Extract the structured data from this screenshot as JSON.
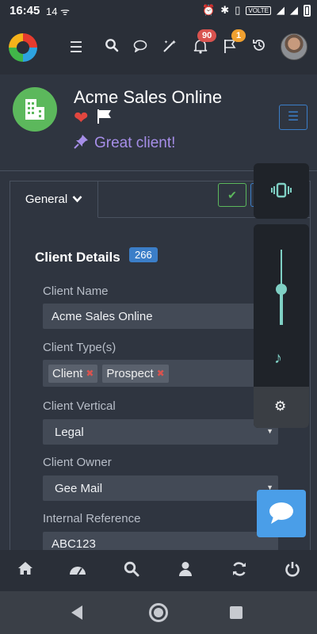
{
  "statusbar": {
    "time": "16:45",
    "left_indicators": "14 ᯤ",
    "volte": "VOLTE"
  },
  "topnav": {
    "notifications_count": "90",
    "flags_count": "1"
  },
  "header": {
    "client_name": "Acme Sales Online",
    "tagline": "Great client!"
  },
  "tabs": {
    "general_label": "General"
  },
  "section": {
    "title": "Client Details",
    "count": "266"
  },
  "form": {
    "client_name_label": "Client Name",
    "client_name_value": "Acme Sales Online",
    "client_types_label": "Client Type(s)",
    "client_types": [
      "Client",
      "Prospect"
    ],
    "client_vertical_label": "Client Vertical",
    "client_vertical_value": "Legal",
    "client_owner_label": "Client Owner",
    "client_owner_value": "Gee Mail",
    "internal_reference_label": "Internal Reference",
    "internal_reference_value": "ABC123"
  },
  "volume": {
    "level": 0.47
  },
  "colors": {
    "accent_blue": "#3b7ec8",
    "success_green": "#5cb85c",
    "tagline_purple": "#a68ee8",
    "volume_teal": "#7fd0c4"
  }
}
